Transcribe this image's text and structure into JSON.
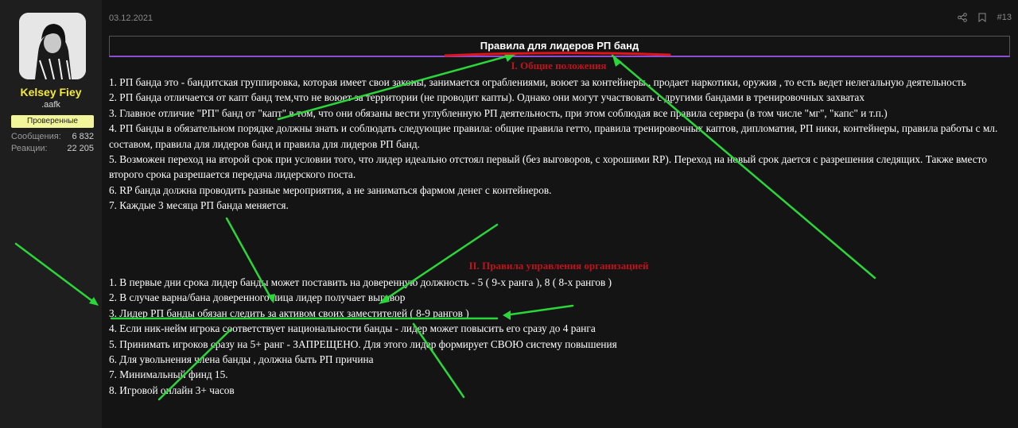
{
  "user": {
    "name": "Kelsey Fiey",
    "title": ".aafk",
    "badge": "Проверенные",
    "stats": [
      {
        "label": "Сообщения:",
        "value": "6 832"
      },
      {
        "label": "Реакции:",
        "value": "22 205"
      }
    ]
  },
  "post": {
    "date": "03.12.2021",
    "number": "#13",
    "title": "Правила для лидеров РП банд",
    "section1_title": "I. Общие положения",
    "section1": [
      "1. РП банда это - бандитская группировка, которая имеет свои законы, занимается ограблениями, воюет за контейнеры , продает наркотики, оружия , то есть ведет нелегальную деятельность",
      "2. РП банда отличается от капт банд тем,что не воюет за территории (не проводит капты). Однако они могут участвовать с другими бандами в тренировочных захватах",
      "3. Главное отличие \"РП\" банд от \"капт\" в том, что они обязаны вести углубленную РП деятельность, при этом соблюдая все правила сервера (в том числе \"мг\", \"капс\" и т.п.)",
      "4. РП банды в обязательном порядке должны знать и соблюдать следующие правила: общие правила гетто, правила тренировочных каптов, дипломатия, РП ники, контейнеры, правила работы с мл. составом, правила для лидеров банд и правила для лидеров РП банд.",
      "5. Возможен переход на второй срок при условии того, что лидер идеально отстоял первый (без выговоров, с хорошими RP). Переход на новый срок дается с разрешения следящих. Также вместо второго срока разрешается передача лидерского поста.",
      "6. RP банда должна проводить разные мероприятия, а не заниматься фармом денег с контейнеров.",
      "7. Каждые 3 месяца РП банда меняется."
    ],
    "section2_title": "II. Правила управления организацией",
    "section2": [
      "1. В первые дни срока лидер банды может поставить на доверенную должность - 5 ( 9-х ранга ), 8 ( 8-х рангов )",
      "2. В случае варна/бана доверенного лица лидер получает выговор",
      "3. Лидер РП банды обязан следить за активом своих заместителей ( 8-9 рангов )",
      "4. Если ник-нейм игрока соответствует национальности банды - лидер может повысить его сразу до 4 ранга",
      "5. Принимать игроков сразу на 5+ ранг - ЗАПРЕЩЕНО. Для этого лидер формирует СВОЮ систему повышения",
      "6. Для увольнения члена банды , должна быть РП причина",
      "7. Минимальный финд 15.",
      "8. Игровой онлайн 3+ часов"
    ]
  },
  "colors": {
    "accent_underline": "#8a4fd6",
    "heading_red": "#c1121b",
    "annotation_green": "#2bd63a",
    "annotation_red": "#e0141a",
    "username_yellow": "#f5ea3a"
  }
}
